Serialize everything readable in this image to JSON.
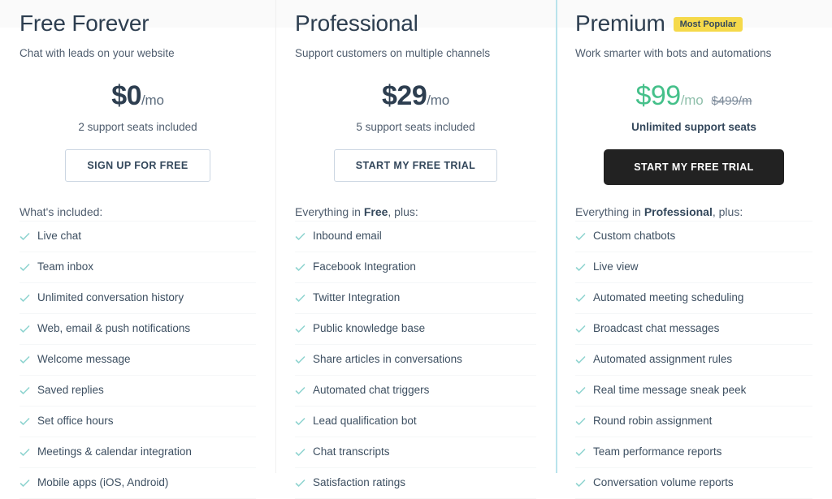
{
  "plans": [
    {
      "name": "Free Forever",
      "badge": null,
      "tagline": "Chat with leads on your website",
      "price": "$0",
      "price_period": "/mo",
      "price_old": null,
      "seats": "2 support seats included",
      "cta_label": "SIGN UP FOR FREE",
      "cta_style": "outline",
      "included_label_prefix": "What's included:",
      "included_label_bold": "",
      "included_label_suffix": "",
      "features": [
        "Live chat",
        "Team inbox",
        "Unlimited conversation history",
        "Web, email & push notifications",
        "Welcome message",
        "Saved replies",
        "Set office hours",
        "Meetings & calendar integration",
        "Mobile apps (iOS, Android)"
      ]
    },
    {
      "name": "Professional",
      "badge": null,
      "tagline": "Support customers on multiple channels",
      "price": "$29",
      "price_period": "/mo",
      "price_old": null,
      "seats": "5 support seats included",
      "cta_label": "START MY FREE TRIAL",
      "cta_style": "outline",
      "included_label_prefix": "Everything in ",
      "included_label_bold": "Free",
      "included_label_suffix": ", plus:",
      "features": [
        "Inbound email",
        "Facebook Integration",
        "Twitter Integration",
        "Public knowledge base",
        "Share articles in conversations",
        "Automated chat triggers",
        "Lead qualification bot",
        "Chat transcripts",
        "Satisfaction ratings"
      ]
    },
    {
      "name": "Premium",
      "badge": "Most Popular",
      "tagline": "Work smarter with bots and automations",
      "price": "$99",
      "price_period": "/mo",
      "price_old": "$499/m",
      "seats": "Unlimited support seats",
      "cta_label": "START MY FREE TRIAL",
      "cta_style": "dark",
      "included_label_prefix": "Everything in ",
      "included_label_bold": "Professional",
      "included_label_suffix": ", plus:",
      "features": [
        "Custom chatbots",
        "Live view",
        "Automated meeting scheduling",
        "Broadcast chat messages",
        "Automated assignment rules",
        "Real time message sneak peek",
        "Round robin assignment",
        "Team performance reports",
        "Conversation volume reports"
      ]
    }
  ],
  "colors": {
    "badge_background": "#f5d94a",
    "premium_price": "#45c08a",
    "check_icon": "#8fd4d0",
    "premium_divider": "#b9e3ec",
    "dark_button": "#222222",
    "text": "#33475b"
  },
  "icons": {
    "check": "check-icon"
  }
}
